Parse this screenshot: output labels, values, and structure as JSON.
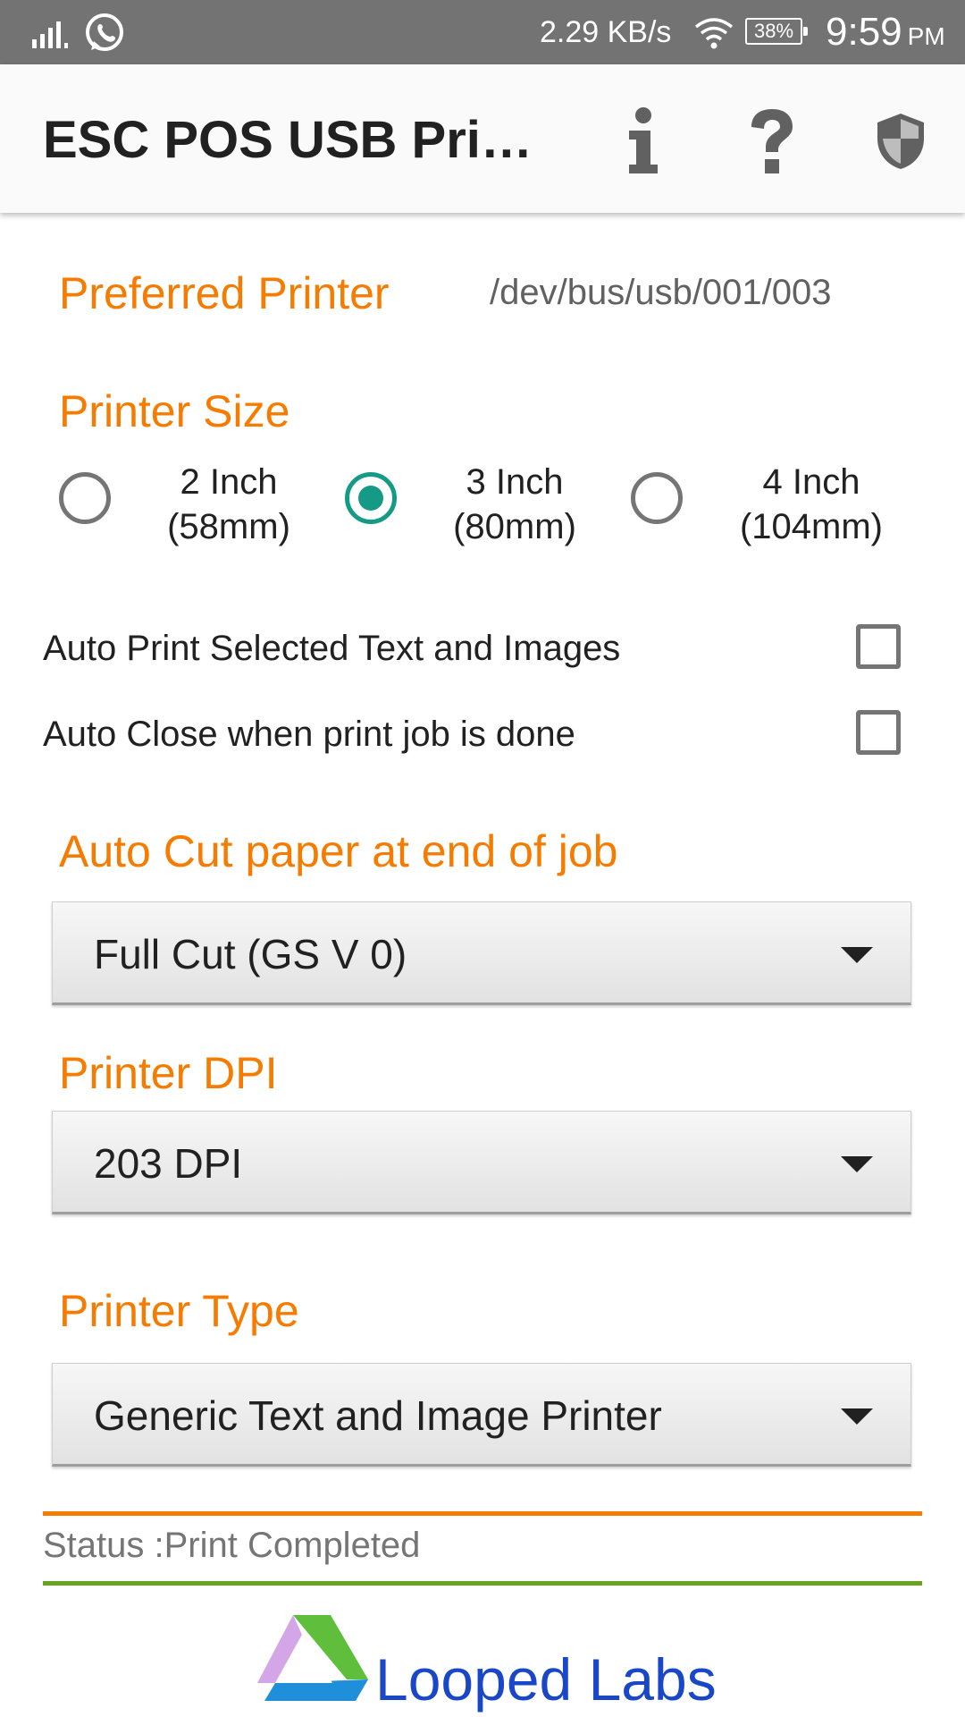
{
  "status_bar": {
    "network_speed": "2.29 KB/s",
    "battery": "38%",
    "time": "9:59",
    "ampm": "PM",
    "icons": [
      "signal-icon",
      "whatsapp-icon",
      "wifi-icon",
      "battery-icon"
    ]
  },
  "app_bar": {
    "title": "ESC POS USB Print...",
    "actions": [
      "info-icon",
      "help-icon",
      "shield-icon"
    ]
  },
  "preferred_printer": {
    "label": "Preferred Printer",
    "value": "/dev/bus/usb/001/003"
  },
  "printer_size": {
    "label": "Printer Size",
    "options": [
      {
        "label": "2 Inch\n(58mm)",
        "checked": false
      },
      {
        "label": "3 Inch\n(80mm)",
        "checked": true
      },
      {
        "label": "4 Inch\n(104mm)",
        "checked": false
      }
    ]
  },
  "options": {
    "auto_print": {
      "label": "Auto Print Selected Text and Images",
      "checked": false
    },
    "auto_close": {
      "label": "Auto Close when print job is done",
      "checked": false
    }
  },
  "auto_cut": {
    "label": "Auto Cut paper at end of job",
    "selected": "Full Cut (GS V 0)"
  },
  "printer_dpi": {
    "label": "Printer DPI",
    "selected": "203 DPI"
  },
  "printer_type": {
    "label": "Printer Type",
    "selected": "Generic Text and Image Printer"
  },
  "status": {
    "text": "Status :Print Completed"
  },
  "footer": {
    "brand": "Looped Labs"
  },
  "colors": {
    "accent_orange": "#f57c00",
    "radio_teal": "#159a86",
    "divider_green": "#6aa222",
    "brand_blue": "#1a47c8"
  }
}
